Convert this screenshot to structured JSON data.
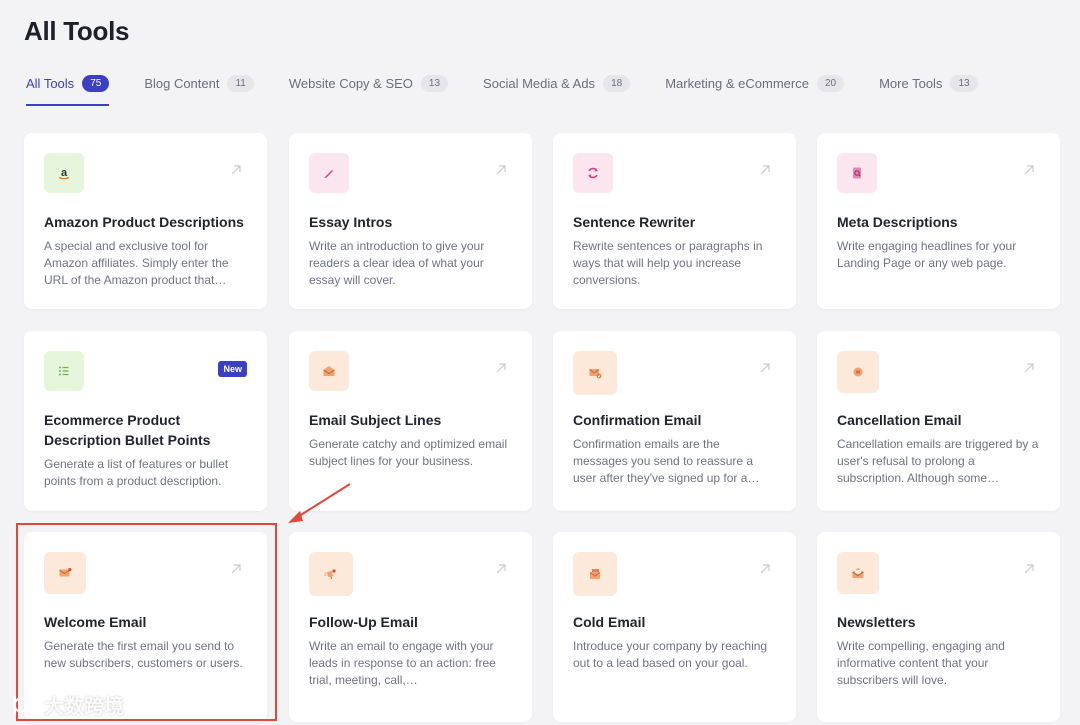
{
  "page": {
    "title": "All Tools"
  },
  "tabs": [
    {
      "label": "All Tools",
      "count": "75",
      "active": true
    },
    {
      "label": "Blog Content",
      "count": "11"
    },
    {
      "label": "Website Copy & SEO",
      "count": "13"
    },
    {
      "label": "Social Media & Ads",
      "count": "18"
    },
    {
      "label": "Marketing & eCommerce",
      "count": "20"
    },
    {
      "label": "More Tools",
      "count": "13"
    }
  ],
  "cards": [
    {
      "title": "Amazon Product Descriptions",
      "desc": "A special and exclusive tool for Amazon affiliates. Simply enter the URL of the Amazon product that…",
      "icon": "amazon-icon",
      "accent": "#e6f6dc"
    },
    {
      "title": "Essay Intros",
      "desc": "Write an introduction to give your readers a clear idea of what your essay will cover.",
      "icon": "pen-icon",
      "accent": "#fbe6f0"
    },
    {
      "title": "Sentence Rewriter",
      "desc": "Rewrite sentences or paragraphs in ways that will help you increase conversions.",
      "icon": "refresh-icon",
      "accent": "#fbe6f0"
    },
    {
      "title": "Meta Descriptions",
      "desc": "Write engaging headlines for your Landing Page or any web page.",
      "icon": "search-doc-icon",
      "accent": "#fbe6f0"
    },
    {
      "title": "Ecommerce Product Description Bullet Points",
      "desc": "Generate a list of features or bullet points from a product description.",
      "icon": "list-icon",
      "accent": "#e6f6dc",
      "badge": "New"
    },
    {
      "title": "Email Subject Lines",
      "desc": "Generate catchy and optimized email subject lines for your business.",
      "icon": "open-envelope-icon",
      "accent": "#fde9d9"
    },
    {
      "title": "Confirmation Email",
      "desc": "Confirmation emails are the messages you send to reassure a user after they've signed up for a…",
      "icon": "envelope-check-icon",
      "accent": "#fde9d9"
    },
    {
      "title": "Cancellation Email",
      "desc": "Cancellation emails are triggered by a user's refusal to prolong a subscription. Although some…",
      "icon": "cancel-icon",
      "accent": "#fde9d9"
    },
    {
      "title": "Welcome Email",
      "desc": "Generate the first email you send to new subscribers, customers or users.",
      "icon": "envelope-dot-icon",
      "accent": "#fde9d9"
    },
    {
      "title": "Follow-Up Email",
      "desc": "Write an email to engage with your leads in response to an action: free trial, meeting, call,…",
      "icon": "envelope-fast-icon",
      "accent": "#fde9d9"
    },
    {
      "title": "Cold Email",
      "desc": "Introduce your company by reaching out to a lead based on your goal.",
      "icon": "envelope-stack-icon",
      "accent": "#fde9d9"
    },
    {
      "title": "Newsletters",
      "desc": "Write compelling, engaging and informative content that your subscribers will love.",
      "icon": "newsletter-icon",
      "accent": "#fde9d9"
    }
  ],
  "watermark": {
    "text": "大数跨境"
  },
  "colors": {
    "primary": "#3b3fc1",
    "highlight": "#e0483a"
  }
}
